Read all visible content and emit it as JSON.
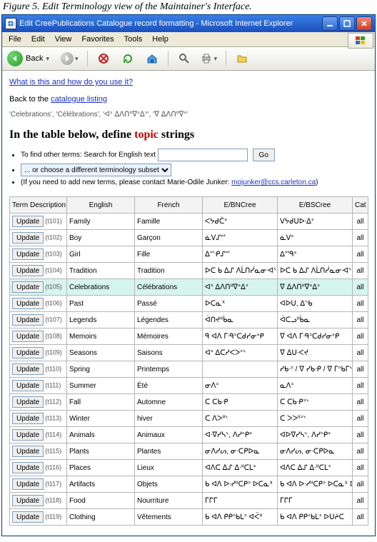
{
  "figure_caption": "Figure 5. Edit Terminology view of the Maintainer's Interface.",
  "window": {
    "title": "Edit CreePublications Catalogue record formatting - Microsoft Internet Explorer",
    "menu": [
      "File",
      "Edit",
      "View",
      "Favorites",
      "Tools",
      "Help"
    ],
    "back_label": "Back"
  },
  "page": {
    "whatlink": "What is this and how do you use it?",
    "back_prefix": "Back to the ",
    "back_link": "catalogue listing",
    "record_line": "'Celebrations', 'Célébrations', 'ᐊᐣ ᐃᐱᑎᐦᐁᐤᐃᐣ', 'ᐁ ᐃᐱᑎᐦᐁᐤ'",
    "heading_a": "In the table below, define ",
    "heading_topic": "topic",
    "heading_b": " strings",
    "bullets": {
      "b1a": "To find other terms: Search for English text ",
      "go": "Go",
      "b2_sel": "... or choose a different terminology subset",
      "b3a": "(If you need to add new terms, please contact Marie-Odile Junker: ",
      "b3_mail": "mojunker@ccs.carleton.ca",
      "b3b": ")"
    },
    "columns": [
      "Term Description",
      "English",
      "French",
      "E/BNCree",
      "E/BSCree",
      "Cat"
    ],
    "update_label": "Update",
    "cat_label": "all",
    "rows": [
      {
        "id": "t101",
        "en": "Family",
        "fr": "Famille",
        "c1": "ᐸᔭᑯᑖᐤ",
        "c2": "ᐯᔭᑯᑌᐅᐧᐃᐣ"
      },
      {
        "id": "t102",
        "en": "Boy",
        "fr": "Garçon",
        "c1": "ᓈᐯᔑᔥ",
        "c2": "ᓈᐯᐤ"
      },
      {
        "id": "t103",
        "en": "Girl",
        "fr": "Fille",
        "c1": "ᐃᔥᑶᔑᔥ",
        "c2": "ᐃᔥᑫᐤ"
      },
      {
        "id": "t104",
        "en": "Tradition",
        "fr": "Tradition",
        "c1": "ᐅᑕ ᑲ ᐃᔑ ᐱᒫᑎᓰᓇᓂᐗᐠ",
        "c2": "ᐅᑕ ᑲ ᐃᔑ ᐱᒫᑎᓰᓇᓂᐗᐠ"
      },
      {
        "id": "t105",
        "en": "Celebrations",
        "fr": "Célébrations",
        "c1": "ᐊᐣ ᐃᐱᑎᐦᐁᐤᐃᐣ",
        "c2": "ᐁ ᐃᐱᑎᐦᐁᐤᐃᐣ",
        "hl": true
      },
      {
        "id": "t106",
        "en": "Past",
        "fr": "Passé",
        "c1": "ᐅᑕᓇᕽ",
        "c2": "ᐊᐅᑌ, ᐃᔅᑲ"
      },
      {
        "id": "t107",
        "en": "Legends",
        "fr": "Légendes",
        "c1": "ᐋᑎᔪᐦᑳᓇ",
        "c2": "ᐋᑕᓗᐦᑳᓇ"
      },
      {
        "id": "t108",
        "en": "Memoirs",
        "fr": "Mémoires",
        "c1": "ᑫ ᐊᐱ ᒥᑴᐣᑕᑯᓯᓂᐤᑭ",
        "c2": "ᐁ ᐊᐱ ᒥᑴᐣᑕᑯᓯᓂᐤᑭ"
      },
      {
        "id": "t109",
        "en": "Seasons",
        "fr": "Saisons",
        "c1": "ᐊᐣ ᐃᑕᓯᐸᐳᐣᐠ",
        "c2": "ᐁ ᐃᑌᐧᐸᔪ"
      },
      {
        "id": "t110",
        "en": "Spring",
        "fr": "Printemps",
        "c1": "",
        "c2": "ᓯᑲᐧᐣ / ᐁ ᓯᑲᐧᑭ / ᐁ ᒥᐢᑲᒥᐠ"
      },
      {
        "id": "t111",
        "en": "Summer",
        "fr": "Été",
        "c1": "ᓂᐱᐣ",
        "c2": "ᓇᐱᐣ"
      },
      {
        "id": "t112",
        "en": "Fall",
        "fr": "Automne",
        "c1": "ᑕ ᑕᑲᐧᑭ",
        "c2": "ᑕ ᑕᑲᐧᑭᐣᐠ"
      },
      {
        "id": "t113",
        "en": "Winter",
        "fr": "hiver",
        "c1": "ᑕ ᐱᐳᐦᐠ",
        "c2": "ᑕ ᐳᐳᐦᐣᐠ"
      },
      {
        "id": "t114",
        "en": "Animals",
        "fr": "Animaux",
        "c1": "ᐊᐧᐁᓯᓴᐠ, ᐱᓯᐢᑭᐤ",
        "c2": "ᐊᐅᐁᓯᓴᐠ, ᐱᓯᐢᑭᐤ"
      },
      {
        "id": "t115",
        "en": "Plants",
        "fr": "Plantes",
        "c1": "ᓂᐱᓯᔕ, ᓂᐧᑕᑭᐅᓇ",
        "c2": "ᓂᐱᓯᔕ, ᓂᐧᑕᑭᐅᓇ"
      },
      {
        "id": "t116",
        "en": "Places",
        "fr": "Lieux",
        "c1": "ᐊᐱᑕ ᐃᔑ ᐃᐧᐦᑕᒪᐣ",
        "c2": "ᐊᐱᑕ ᐃᔑ ᐃᐧᐦᑕᒪᐣ"
      },
      {
        "id": "t117",
        "en": "Artifacts",
        "fr": "Objets",
        "c1": "ᑲ ᐊᐱ ᐅᐧᓯᐦᑕᑭᐣ ᐅᑕᓇᕽ",
        "c2": "ᑲ ᐊᐱ ᐅᐧᓯᐦᑕᑭᐣ ᐅᑕᓇᕽ ᐅᑖᓯ"
      },
      {
        "id": "t118",
        "en": "Food",
        "fr": "Nourriture",
        "c1": "ᒥᒋᒥ",
        "c2": "ᒥᒋᒥ"
      },
      {
        "id": "t119",
        "en": "Clothing",
        "fr": "Vêtements",
        "c1": "ᑲ ᐊᐱ ᑭᑭᐢᑲᒪᐣ ᐊᑈᐦ",
        "c2": "ᑲ ᐊᐱ ᑭᑭᐢᑲᒪᐣ ᐅᑌᔨᑕ"
      }
    ]
  }
}
